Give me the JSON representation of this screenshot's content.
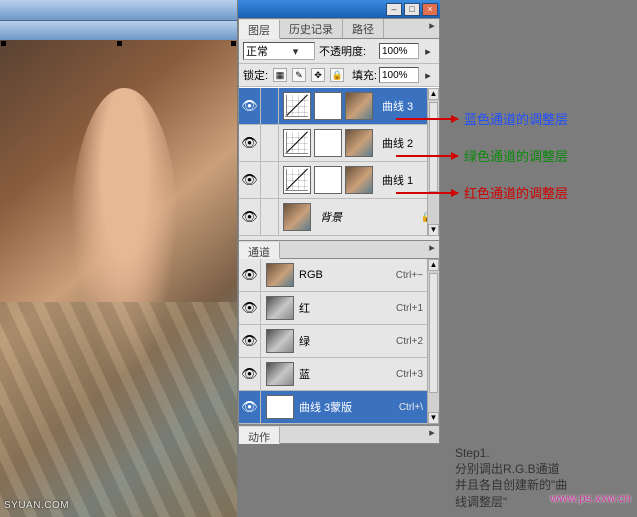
{
  "canvas": {
    "watermark": "SYUAN.COM"
  },
  "window": {
    "min": "–",
    "max": "□",
    "close": "×"
  },
  "layers_panel": {
    "tabs": {
      "layers": "图层",
      "history": "历史记录",
      "paths": "路径"
    },
    "blend_label": "正常",
    "opacity_label": "不透明度:",
    "opacity_value": "100%",
    "lock_label": "锁定:",
    "fill_label": "填充:",
    "fill_value": "100%",
    "rows": [
      {
        "name": "曲线 3"
      },
      {
        "name": "曲线 2"
      },
      {
        "name": "曲线 1"
      },
      {
        "name": "背景"
      }
    ]
  },
  "channels_panel": {
    "tab": "通道",
    "rows": [
      {
        "name": "RGB",
        "shortcut": "Ctrl+~"
      },
      {
        "name": "红",
        "shortcut": "Ctrl+1"
      },
      {
        "name": "绿",
        "shortcut": "Ctrl+2"
      },
      {
        "name": "蓝",
        "shortcut": "Ctrl+3"
      },
      {
        "name": "曲线 3蒙版",
        "shortcut": "Ctrl+\\"
      }
    ]
  },
  "actions_panel": {
    "tab": "动作"
  },
  "annotations": {
    "blue": "蓝色通道的调整层",
    "green": "绿色通道的调整层",
    "red": "红色通道的调整层"
  },
  "step": {
    "title": "Step1.",
    "line1": "分别调出R.G.B通道",
    "line2": "并且各自创建新的\"曲",
    "line3": "线调整层\""
  },
  "watermark2": {
    "a": "",
    "b": "www.ps.xxw.cn"
  }
}
